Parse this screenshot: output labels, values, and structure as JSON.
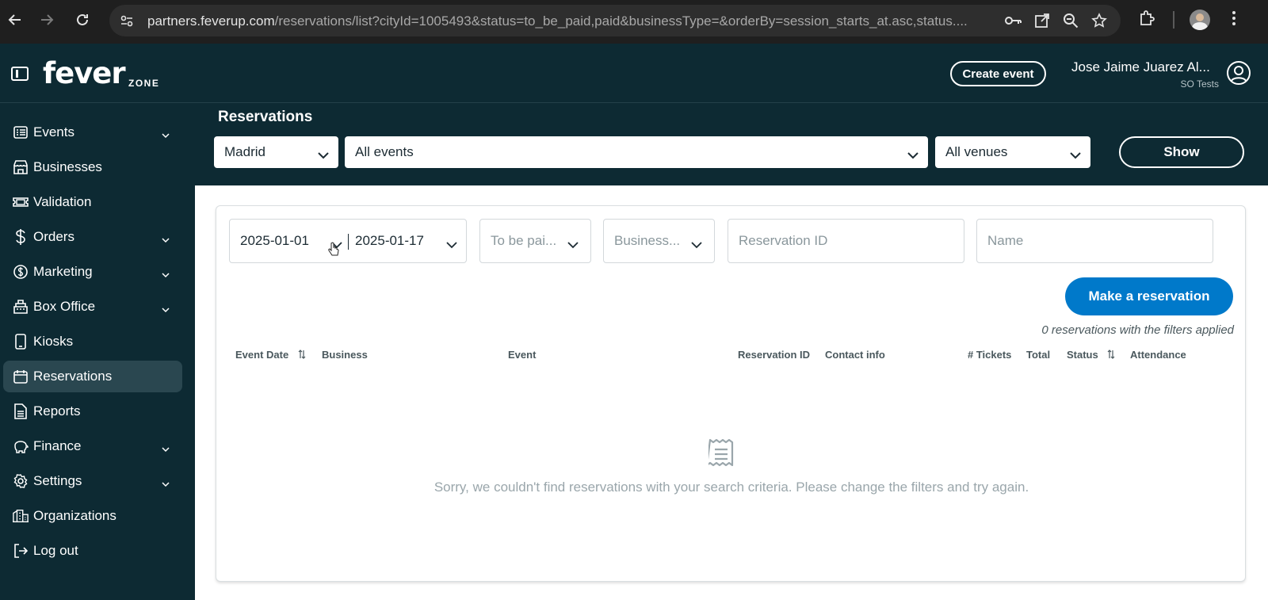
{
  "browser": {
    "url_host": "partners.feverup.com",
    "url_path": "/reservations/list?cityId=1005493&status=to_be_paid,paid&businessType=&orderBy=session_starts_at.asc,status...."
  },
  "header": {
    "logo": "fever",
    "logo_sub": "ZONE",
    "create_event": "Create event",
    "user_name": "Jose Jaime Juarez Al...",
    "user_org": "SO Tests"
  },
  "sidebar": {
    "items": [
      {
        "label": "Events",
        "icon": "list-icon",
        "has_chevron": true
      },
      {
        "label": "Businesses",
        "icon": "store-icon",
        "has_chevron": false
      },
      {
        "label": "Validation",
        "icon": "ticket-icon",
        "has_chevron": false
      },
      {
        "label": "Orders",
        "icon": "dollar-icon",
        "has_chevron": true
      },
      {
        "label": "Marketing",
        "icon": "coin-icon",
        "has_chevron": true
      },
      {
        "label": "Box Office",
        "icon": "cash-register-icon",
        "has_chevron": true
      },
      {
        "label": "Kiosks",
        "icon": "kiosk-icon",
        "has_chevron": false
      },
      {
        "label": "Reservations",
        "icon": "calendar-icon",
        "has_chevron": false,
        "active": true
      },
      {
        "label": "Reports",
        "icon": "document-icon",
        "has_chevron": false
      },
      {
        "label": "Finance",
        "icon": "piggy-bank-icon",
        "has_chevron": true
      },
      {
        "label": "Settings",
        "icon": "gear-icon",
        "has_chevron": true
      },
      {
        "label": "Organizations",
        "icon": "buildings-icon",
        "has_chevron": false
      },
      {
        "label": "Log out",
        "icon": "logout-icon",
        "has_chevron": false
      }
    ]
  },
  "top_filters": {
    "title": "Reservations",
    "city": "Madrid",
    "events": "All events",
    "venues": "All venues",
    "show": "Show"
  },
  "filters": {
    "date_from": "2025-01-01",
    "date_to": "2025-01-17",
    "status": "To be pai...",
    "business": "Business...",
    "reservation_id_placeholder": "Reservation ID",
    "name_placeholder": "Name"
  },
  "actions": {
    "make_reservation": "Make a reservation",
    "count_text": "0 reservations with the filters applied"
  },
  "table": {
    "columns": [
      "Event Date",
      "Business",
      "Event",
      "Reservation ID",
      "Contact info",
      "# Tickets",
      "Total",
      "Status",
      "Attendance"
    ]
  },
  "empty_state": {
    "message": "Sorry, we couldn't find reservations with your search criteria. Please change the filters and try again."
  },
  "colors": {
    "dark_bg": "#0d2a33",
    "primary": "#0079ca",
    "active_nav": "#2a4750"
  }
}
